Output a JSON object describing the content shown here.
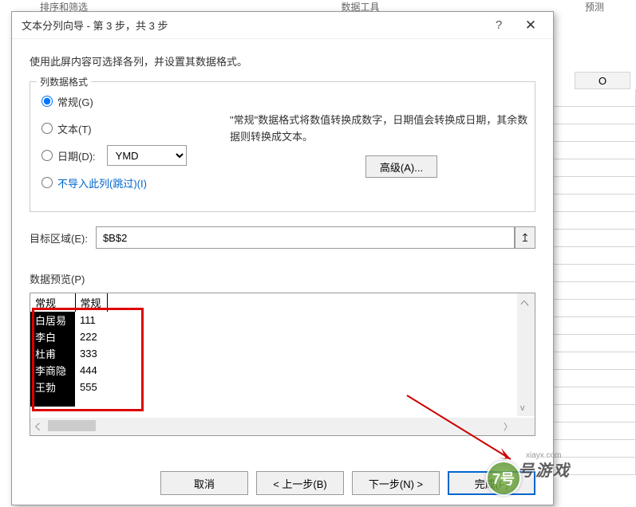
{
  "ribbon": {
    "group1": "排序和筛选",
    "group2": "数据工具",
    "group3": "预测"
  },
  "sheet": {
    "col_o": "O"
  },
  "dialog": {
    "title": "文本分列向导 - 第 3 步，共 3 步",
    "help": "?",
    "close": "✕",
    "description": "使用此屏内容可选择各列，并设置其数据格式。",
    "format_legend": "列数据格式",
    "opt_general": "常规(G)",
    "opt_text": "文本(T)",
    "opt_date": "日期(D):",
    "date_format": "YMD",
    "opt_skip": "不导入此列(跳过)(I)",
    "info_text": "\"常规\"数据格式将数值转换成数字，日期值会转换成日期，其余数据则转换成文本。",
    "advanced_btn": "高级(A)...",
    "target_label": "目标区域(E):",
    "target_value": "$B$2",
    "preview_label": "数据预览(P)",
    "preview": {
      "headers": [
        "常规",
        "常规"
      ],
      "rows": [
        [
          "白居易",
          "111"
        ],
        [
          "李白",
          "222"
        ],
        [
          "杜甫",
          "333"
        ],
        [
          "李商隐",
          "444"
        ],
        [
          "王勃",
          "555"
        ]
      ]
    },
    "btn_cancel": "取消",
    "btn_back": "< 上一步(B)",
    "btn_next": "下一步(N) >",
    "btn_finish": "完成(F)"
  },
  "watermark": {
    "badge": "7号",
    "text": "号游戏",
    "url": "xiayx.com"
  }
}
